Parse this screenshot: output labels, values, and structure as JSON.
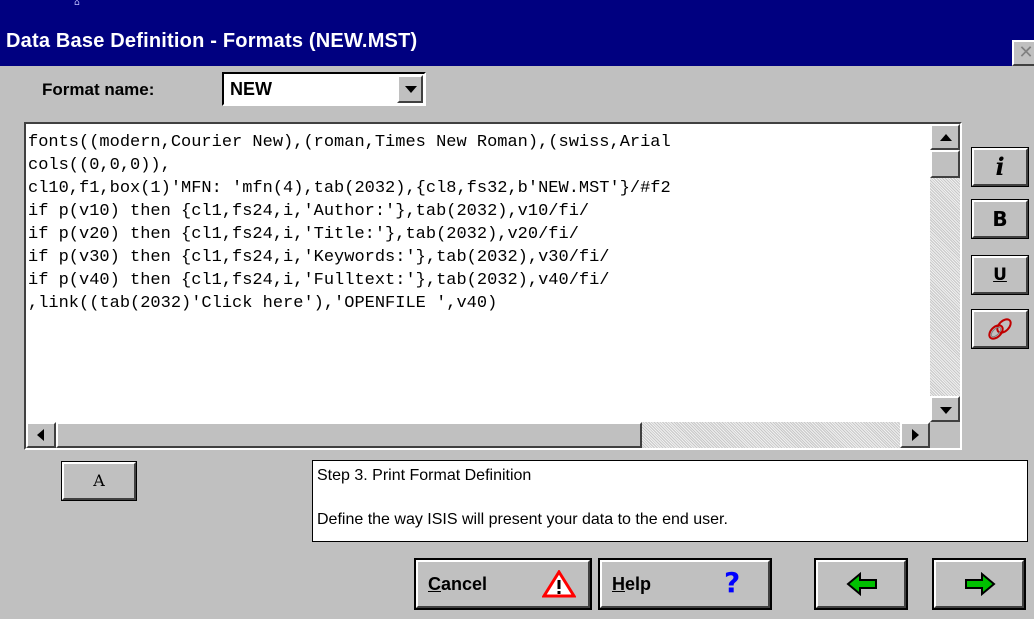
{
  "window": {
    "title": "Data Base Definition - Formats (NEW.MST)",
    "close_glyph": "✕"
  },
  "format_name": {
    "label": "Format name:",
    "value": "NEW"
  },
  "editor": {
    "lines": [
      "fonts((modern,Courier New),(roman,Times New Roman),(swiss,Arial",
      "cols((0,0,0)),",
      "cl10,f1,box(1)'MFN: 'mfn(4),tab(2032),{cl8,fs32,b'NEW.MST'}/#f2",
      "if p(v10) then {cl1,fs24,i,'Author:'},tab(2032),v10/fi/",
      "if p(v20) then {cl1,fs24,i,'Title:'},tab(2032),v20/fi/",
      "if p(v30) then {cl1,fs24,i,'Keywords:'},tab(2032),v30/fi/",
      "if p(v40) then {cl1,fs24,i,'Fulltext:'},tab(2032),v40/fi/",
      ",link((tab(2032)'Click here'),'OPENFILE ',v40)"
    ]
  },
  "format_buttons": {
    "italic": "i",
    "bold": "B",
    "underline": "U"
  },
  "font_button": {
    "label": "A"
  },
  "info": {
    "step": "Step 3. Print Format Definition",
    "description": "Define the way ISIS will present your data to the end user."
  },
  "buttons": {
    "cancel_u": "C",
    "cancel_rest": "ancel",
    "help_u": "H",
    "help_rest": "elp",
    "back": "⇦",
    "next": "⇨"
  },
  "colors": {
    "title_bar": "#000080",
    "face": "#c0c0c0",
    "help_icon": "#0000ff",
    "arrow_green": "#00c000",
    "warning_red": "#ff0000"
  }
}
